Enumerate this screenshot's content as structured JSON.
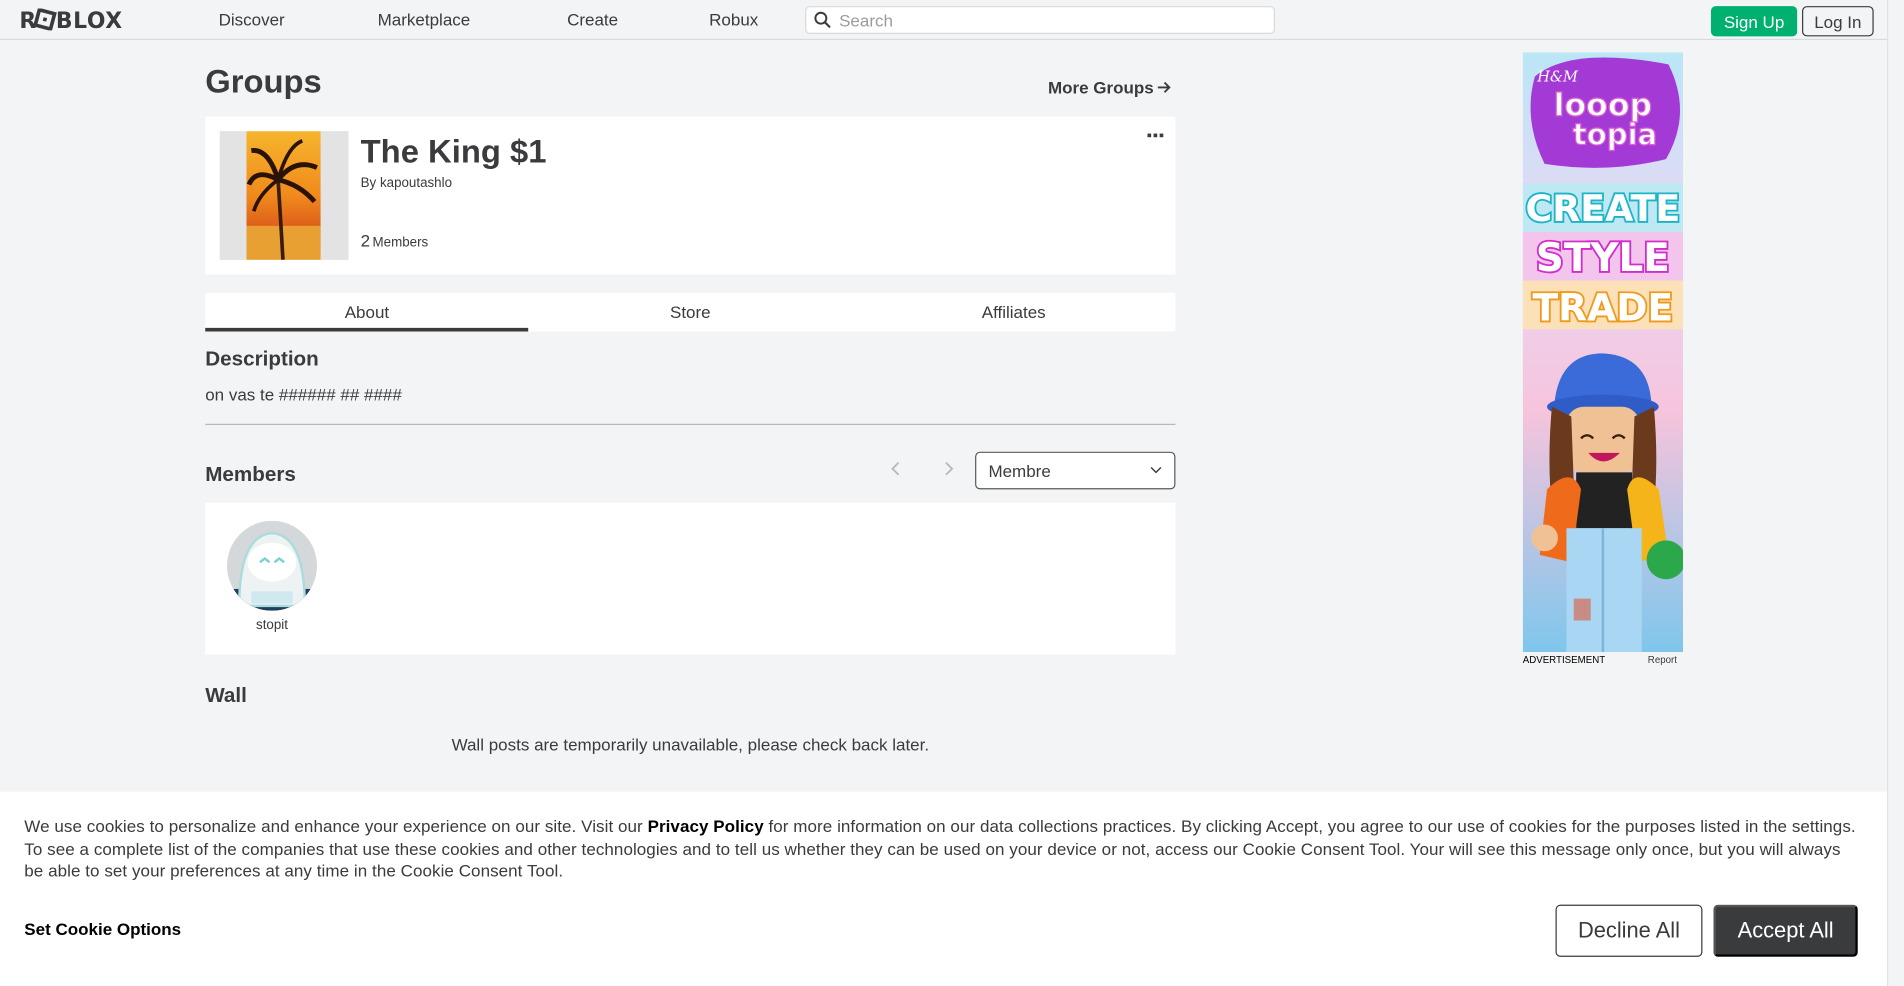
{
  "header": {
    "logo_text": "ROBLOX",
    "nav": [
      {
        "label": "Discover"
      },
      {
        "label": "Marketplace"
      },
      {
        "label": "Create"
      },
      {
        "label": "Robux"
      }
    ],
    "search_placeholder": "Search",
    "signup_label": "Sign Up",
    "login_label": "Log In"
  },
  "page": {
    "title": "Groups",
    "more_groups_label": "More Groups"
  },
  "group": {
    "name": "The King $1",
    "owner_prefix": "By",
    "owner_name": "kapoutashlo",
    "member_count": "2",
    "member_label": "Members"
  },
  "tabs": [
    {
      "label": "About",
      "active": true
    },
    {
      "label": "Store",
      "active": false
    },
    {
      "label": "Affiliates",
      "active": false
    }
  ],
  "description": {
    "title": "Description",
    "text": "on vas te ###### ## ####"
  },
  "members": {
    "title": "Members",
    "role_selected": "Membre",
    "list": [
      {
        "name": "stopit"
      }
    ]
  },
  "wall": {
    "title": "Wall",
    "message": "Wall posts are temporarily unavailable, please check back later."
  },
  "ad": {
    "brand_text": "H&M",
    "headline_text": "looop topia",
    "line1": "CREATE",
    "line2": "STYLE",
    "line3": "TRADE",
    "label": "ADVERTISEMENT",
    "report_label": "Report"
  },
  "cookie": {
    "text_before": "We use cookies to personalize and enhance your experience on our site. Visit our ",
    "link_text": "Privacy Policy",
    "text_after": " for more information on our data collections practices. By clicking Accept, you agree to our use of cookies for the purposes listed in the settings. To see a complete list of the companies that use these cookies and other technologies and to tell us whether they can be used on your device or not, access our Cookie Consent Tool. Your will see this message only once, but you will always be able to set your preferences at any time in the Cookie Consent Tool.",
    "set_options_label": "Set Cookie Options",
    "decline_label": "Decline All",
    "accept_label": "Accept All"
  },
  "colors": {
    "accent_green": "#00b06f",
    "text_dark": "#393b3d",
    "background": "#f2f4f5"
  }
}
